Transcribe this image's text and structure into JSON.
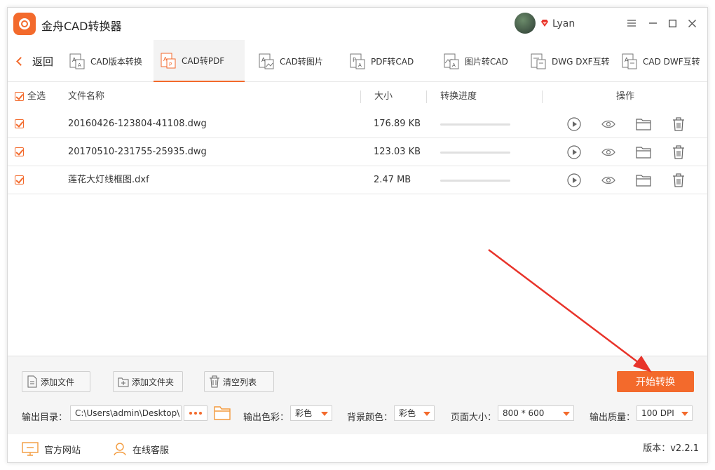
{
  "app": {
    "title": "金舟CAD转换器",
    "username": "Lyan",
    "colors": {
      "accent": "#f36a2c",
      "arrow": "#e8332a"
    }
  },
  "nav": {
    "back_label": "返回",
    "tabs": [
      {
        "label": "CAD版本转换",
        "icon": "cad-version-icon"
      },
      {
        "label": "CAD转PDF",
        "icon": "cad-to-pdf-icon",
        "active": true
      },
      {
        "label": "CAD转图片",
        "icon": "cad-to-image-icon"
      },
      {
        "label": "PDF转CAD",
        "icon": "pdf-to-cad-icon"
      },
      {
        "label": "图片转CAD",
        "icon": "image-to-cad-icon"
      },
      {
        "label": "DWG DXF互转",
        "icon": "dwg-dxf-icon"
      },
      {
        "label": "CAD DWF互转",
        "icon": "cad-dwf-icon"
      }
    ]
  },
  "table": {
    "headers": {
      "select_all": "全选",
      "name": "文件名称",
      "size": "大小",
      "progress": "转换进度",
      "actions": "操作"
    },
    "rows": [
      {
        "name": "20160426-123804-41108.dwg",
        "size": "176.89 KB",
        "progress": 0,
        "checked": true
      },
      {
        "name": "20170510-231755-25935.dwg",
        "size": "123.03 KB",
        "progress": 0,
        "checked": true
      },
      {
        "name": "莲花大灯线框图.dxf",
        "size": "2.47 MB",
        "progress": 0,
        "checked": true
      }
    ]
  },
  "toolbar": {
    "add_file": "添加文件",
    "add_folder": "添加文件夹",
    "clear_list": "清空列表",
    "start": "开始转换"
  },
  "options": {
    "output_dir_label": "输出目录：",
    "output_dir_value": "C:\\Users\\admin\\Desktop\\",
    "color_label": "输出色彩：",
    "color_value": "彩色",
    "bg_label": "背景颜色：",
    "bg_value": "彩色",
    "page_label": "页面大小：",
    "page_value": "800 * 600",
    "quality_label": "输出质量：",
    "quality_value": "100 DPI"
  },
  "footer": {
    "website": "官方网站",
    "support": "在线客服",
    "version": "版本：v2.2.1"
  }
}
